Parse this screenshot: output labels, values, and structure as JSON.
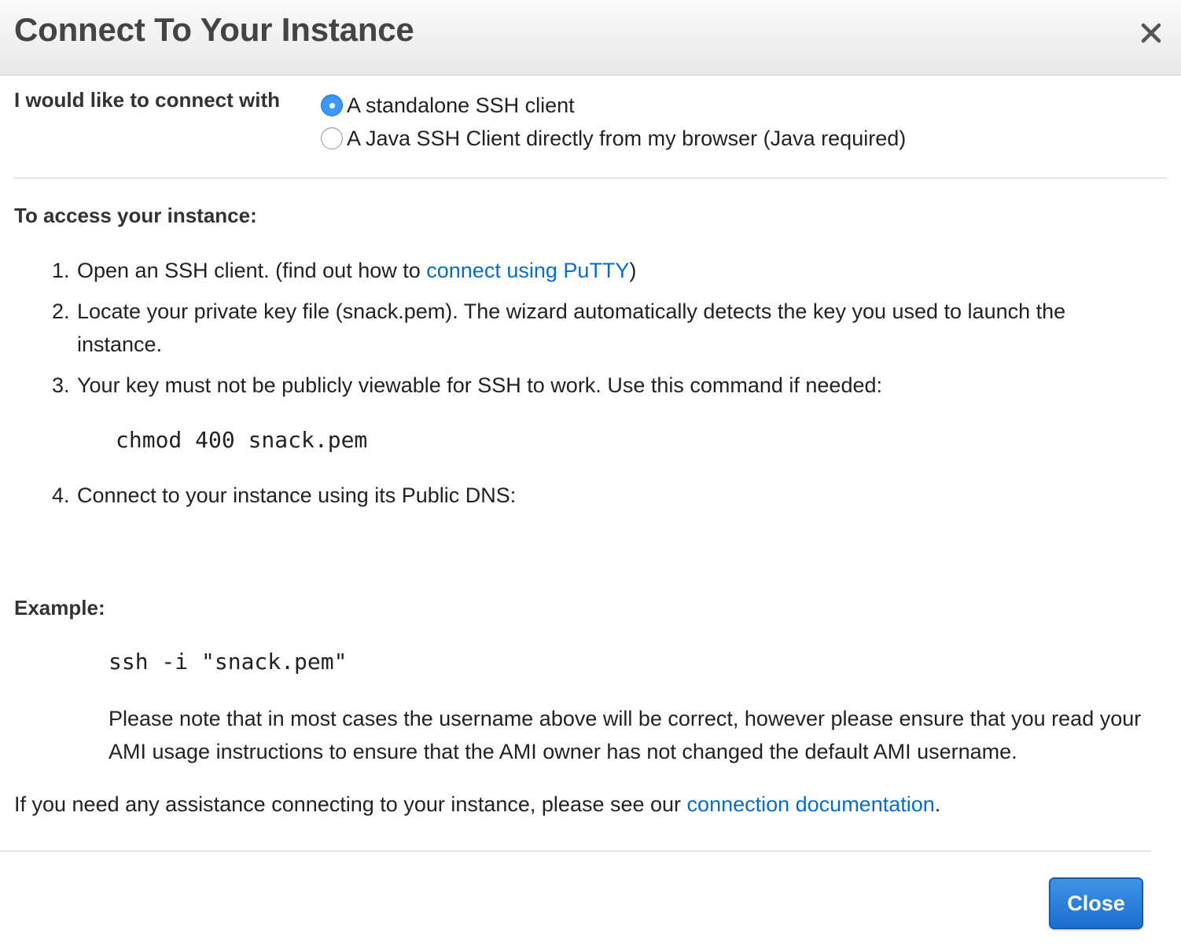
{
  "dialog": {
    "title": "Connect To Your Instance",
    "close_icon": "close-icon"
  },
  "connect_with": {
    "label": "I would like to connect with",
    "options": [
      {
        "label": "A standalone SSH client",
        "selected": true
      },
      {
        "label": "A Java SSH Client directly from my browser (Java required)",
        "selected": false
      }
    ]
  },
  "access": {
    "heading": "To access your instance:",
    "steps": [
      {
        "number": "1.",
        "text_before": "Open an SSH client. (find out how to ",
        "link": "connect using PuTTY",
        "text_after": ")"
      },
      {
        "number": "2.",
        "line1": "Locate your private key file (snack.pem). The wizard automatically detects the key you used to launch the",
        "line2": "instance."
      },
      {
        "number": "3.",
        "text": "Your key must not be publicly viewable for SSH to work. Use this command if needed:"
      },
      {
        "number": "4.",
        "text": "Connect to your instance using its Public DNS:"
      }
    ],
    "chmod_command": "chmod 400 snack.pem"
  },
  "example": {
    "heading": "Example:",
    "command": "ssh -i \"snack.pem\"",
    "note": "Please note that in most cases the username above will be correct, however please ensure that you read your AMI usage instructions to ensure that the AMI owner has not changed the default AMI username."
  },
  "help": {
    "text_before": "If you need any assistance connecting to your instance, please see our ",
    "link": "connection documentation",
    "text_after": "."
  },
  "footer": {
    "close_label": "Close"
  },
  "colors": {
    "link": "#0a6cc9",
    "primary_button": "#1b6ed0",
    "radio_selected": "#3b99fc"
  }
}
